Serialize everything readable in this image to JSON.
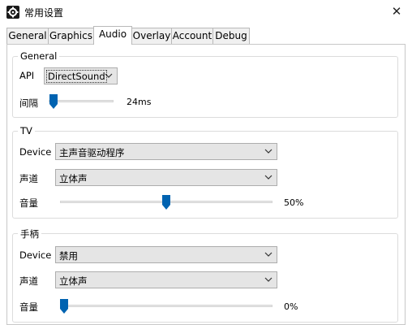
{
  "window": {
    "title": "常用设置",
    "app_icon": "gear-icon",
    "close_glyph": "✕"
  },
  "tabs": [
    {
      "label": "General",
      "active": false
    },
    {
      "label": "Graphics",
      "active": false
    },
    {
      "label": "Audio",
      "active": true
    },
    {
      "label": "Overlay",
      "active": false
    },
    {
      "label": "Account",
      "active": false
    },
    {
      "label": "Debug",
      "active": false
    }
  ],
  "general": {
    "title": "General",
    "api_label": "API",
    "api_value": "DirectSound",
    "latency_label": "间隔",
    "latency_value": "24ms",
    "latency_level": 0.02
  },
  "tv": {
    "title": "TV",
    "device_label": "Device",
    "device_value": "主声音驱动程序",
    "channel_label": "声道",
    "channel_value": "立体声",
    "volume_label": "音量",
    "volume_value": "50%",
    "volume_level": 0.5
  },
  "gamepad": {
    "title": "手柄",
    "device_label": "Device",
    "device_value": "禁用",
    "channel_label": "声道",
    "channel_value": "立体声",
    "volume_label": "音量",
    "volume_value": "0%",
    "volume_level": 0.0
  },
  "colors": {
    "accent": "#0063b1",
    "combo_bg": "#e5e5e5",
    "border": "#adadad"
  }
}
